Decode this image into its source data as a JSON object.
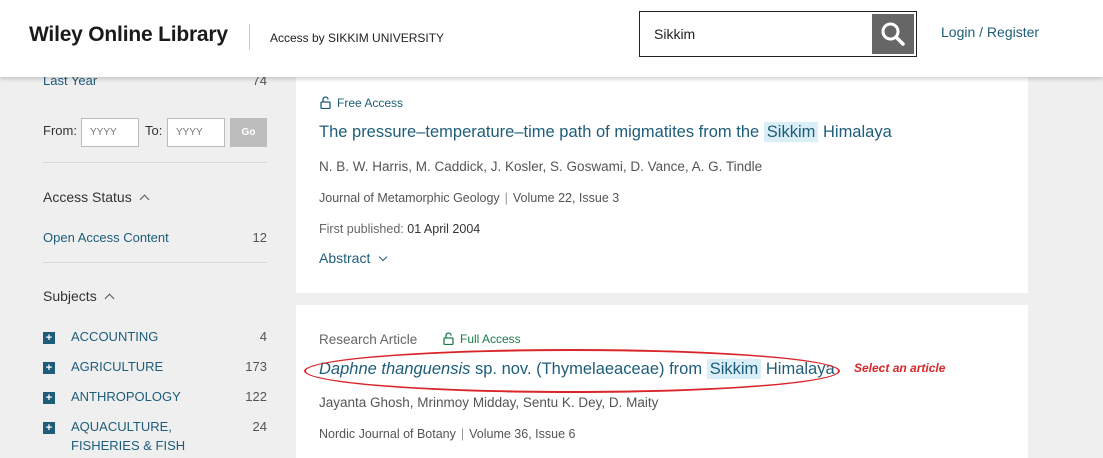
{
  "header": {
    "logo": "Wiley Online Library",
    "access_prefix": "Access by",
    "institution": "SIKKIM UNIVERSITY",
    "search_value": "Sikkim",
    "login_label": "Login / Register"
  },
  "sidebar": {
    "last_year_label": "Last Year",
    "last_year_count": "74",
    "from_label": "From:",
    "to_label": "To:",
    "from_placeholder": "YYYY",
    "to_placeholder": "YYYY",
    "go_label": "Go",
    "access_status": {
      "heading": "Access Status",
      "item_label": "Open Access Content",
      "item_count": "12"
    },
    "subjects": {
      "heading": "Subjects",
      "items": [
        {
          "label": "ACCOUNTING",
          "count": "4"
        },
        {
          "label": "AGRICULTURE",
          "count": "173"
        },
        {
          "label": "ANTHROPOLOGY",
          "count": "122"
        },
        {
          "label": "AQUACULTURE, FISHERIES & FISH",
          "count": "24"
        }
      ]
    }
  },
  "results": [
    {
      "access_badge": "Free Access",
      "title_before": "The pressure–temperature–time path of migmatites from the",
      "title_highlight": "Sikkim",
      "title_after": "Himalaya",
      "authors": "N. B. W. Harris, M. Caddick, J. Kosler, S. Goswami, D. Vance, A. G. Tindle",
      "journal": "Journal of Metamorphic Geology",
      "volume": "Volume 22, Issue 3",
      "first_published_label": "First published:",
      "first_published_value": "01 April 2004",
      "abstract_label": "Abstract"
    },
    {
      "article_type": "Research Article",
      "access_badge": "Full Access",
      "title_italic": "Daphne thanguensis",
      "title_before": "sp. nov. (Thymelaeaceae) from",
      "title_highlight": "Sikkim",
      "title_after": "Himalaya",
      "authors": "Jayanta Ghosh, Mrinmoy Midday, Sentu K. Dey, D. Maity",
      "journal": "Nordic Journal of Botany",
      "volume": "Volume 36, Issue 6"
    }
  ],
  "annotation": {
    "text": "Select an article",
    "color": "#d9262b"
  },
  "colors": {
    "link": "#1d5d7a",
    "highlight": "#d9eef6",
    "full_access": "#1d7a4a"
  }
}
